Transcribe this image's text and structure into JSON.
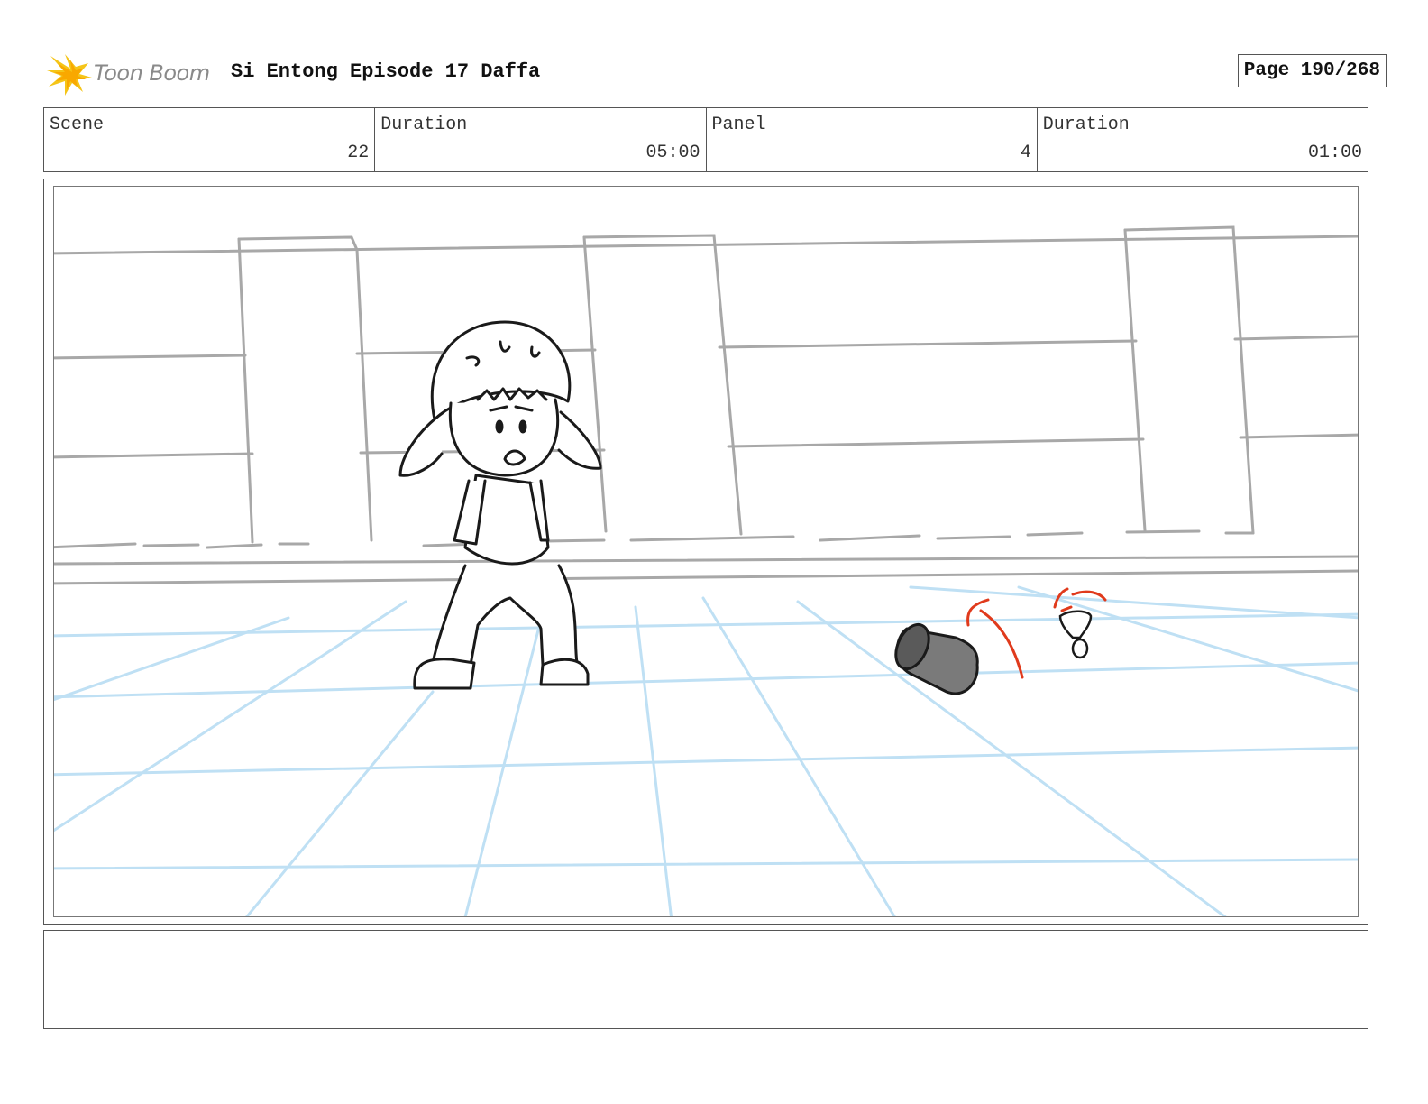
{
  "header": {
    "logo_text": "Toon Boom",
    "title": "Si Entong Episode 17 Daffa",
    "page_label": "Page 190/268"
  },
  "info": {
    "scene_label": "Scene",
    "scene_value": "22",
    "scene_duration_label": "Duration",
    "scene_duration_value": "05:00",
    "panel_label": "Panel",
    "panel_value": "4",
    "panel_duration_label": "Duration",
    "panel_duration_value": "01:00"
  },
  "panel": {
    "sketch_colors": {
      "wall_lines": "#a8a8a8",
      "floor_grid": "#bfe0f4",
      "character_ink": "#1a1a1a",
      "object_fill": "#7a7a7a",
      "motion_arrows": "#e03a1c"
    }
  },
  "colors": {
    "logo_star": "#f5c518",
    "logo_text": "#8a8a8a",
    "border": "#555555"
  }
}
